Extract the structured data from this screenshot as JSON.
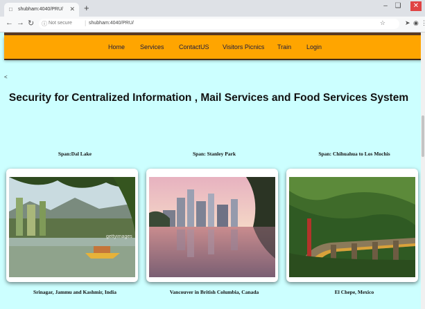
{
  "browser": {
    "tab_title": "shubham:4040/PRU/",
    "security": "Not secure",
    "url": "shubham:4040/PRU/"
  },
  "nav": {
    "items": [
      "Home",
      "Services",
      "ContactUS",
      "Visitors Picnics",
      "Train",
      "Login"
    ]
  },
  "page": {
    "back_arrow": "<",
    "title": "Security for Centralized Information , Mail Services and Food Services System"
  },
  "cards": [
    {
      "span": "Span:Dal Lake",
      "caption": "Srinagar, Jammu and Kashmir, India",
      "watermark": "gettyimages"
    },
    {
      "span": "Span: Stanley Park",
      "caption": "Vancouver in British Columbia, Canada"
    },
    {
      "span": "Span: Chihuahua to Los Mochis",
      "caption": "El Chepe, Mexico"
    }
  ],
  "colors": {
    "page_bg": "#ccffff",
    "nav_bg": "#ffa500"
  }
}
